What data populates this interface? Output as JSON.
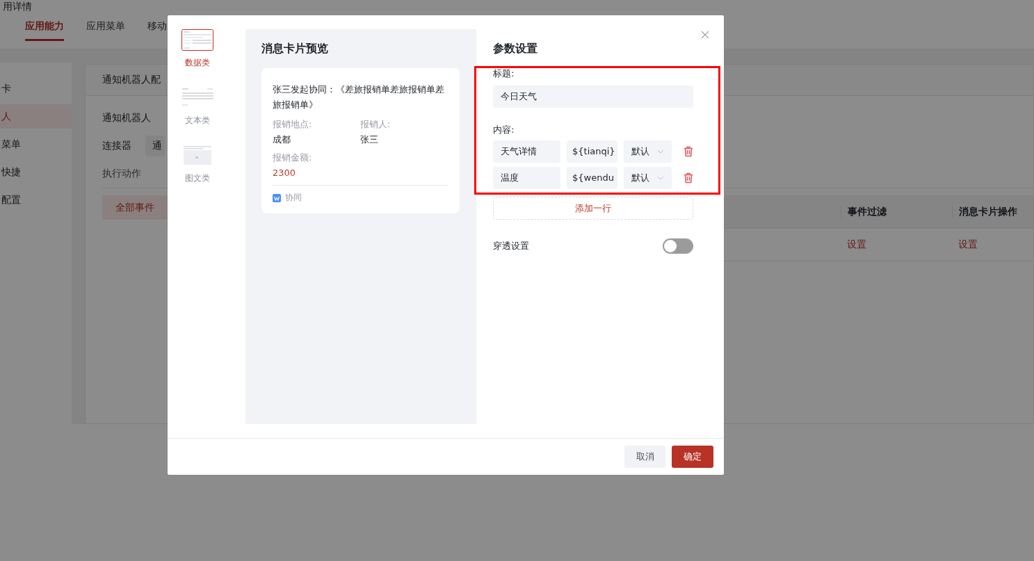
{
  "background_page": {
    "title": "用详情",
    "tabs": [
      {
        "label": "应用能力",
        "selected": true
      },
      {
        "label": "应用菜单",
        "selected": false
      },
      {
        "label": "移动",
        "selected": false
      }
    ],
    "sidebar": {
      "items": [
        {
          "label": "卡",
          "selected": false
        },
        {
          "label": "人",
          "selected": true
        },
        {
          "label": "菜单",
          "selected": false
        },
        {
          "label": "快捷",
          "selected": false
        },
        {
          "label": "配置",
          "selected": false
        }
      ]
    },
    "panel": {
      "title": "通知机器人配",
      "robot_label": "通知机器人",
      "connector_label": "连接器",
      "connector_value": "通",
      "action_tabs": [
        {
          "label": "执行动作",
          "selected": false
        }
      ],
      "filter_button": "全部事件",
      "table": {
        "columns": [
          "事件过滤",
          "消息卡片操作"
        ],
        "rows": [
          [
            "设置",
            "设置"
          ]
        ]
      }
    }
  },
  "dialog": {
    "card_types": [
      {
        "label": "数据类",
        "kind": "data",
        "selected": true
      },
      {
        "label": "文本类",
        "kind": "text",
        "selected": false
      },
      {
        "label": "图文类",
        "kind": "image",
        "selected": false
      }
    ],
    "preview": {
      "title": "消息卡片预览",
      "card": {
        "headline": "张三发起协同：《差旅报销单差旅报销单差旅报销单》",
        "fields": [
          {
            "label": "报销地点:",
            "value": "成都",
            "kind": "plain"
          },
          {
            "label": "报销人:",
            "value": "张三",
            "kind": "plain"
          },
          {
            "label": "报销金额:",
            "value": "2300",
            "kind": "amount"
          }
        ],
        "source": "协同"
      }
    },
    "params": {
      "title": "参数设置",
      "title_label": "标题:",
      "title_value": "今日天气",
      "content_label": "内容:",
      "content_rows": [
        {
          "name": "天气详情",
          "variable": "${tianqi}",
          "style": "默认"
        },
        {
          "name": "温度",
          "variable": "${wendu",
          "style": "默认"
        }
      ],
      "add_row": "添加一行",
      "passthrough": {
        "label": "穿透设置",
        "on": false
      }
    },
    "buttons": [
      {
        "label": "取消",
        "kind": "secondary"
      },
      {
        "label": "确定",
        "kind": "primary"
      }
    ]
  }
}
